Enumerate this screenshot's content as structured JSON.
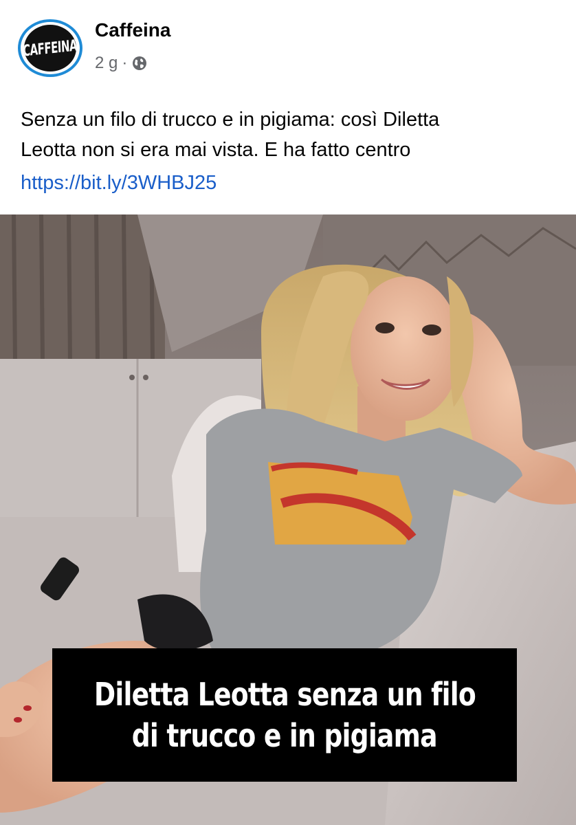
{
  "post": {
    "page_name": "Caffeina",
    "avatar_logo_text": "CAFFEINA",
    "time": "2 g",
    "separator": "·",
    "privacy_icon": "globe-icon",
    "caption_lines": [
      "Senza un filo di trucco e in pigiama: così Diletta",
      "Leotta non si era mai vista. E ha fatto centro"
    ],
    "link": "https://bit.ly/3WHBJ25",
    "image": {
      "overlay_lines": [
        "Diletta Leotta senza un filo",
        "di trucco e in pigiama"
      ]
    }
  },
  "colors": {
    "avatar_ring": "#1f8bd6",
    "link": "#1a5ec9",
    "meta": "#65676b"
  }
}
